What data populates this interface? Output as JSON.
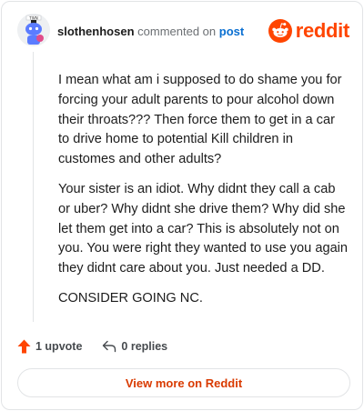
{
  "comment": {
    "username": "slothenhosen",
    "action_text": "commented on",
    "post_link_text": "post",
    "avatar_icon": "snoo-avatar-icon",
    "paragraphs": [
      "I mean what am i supposed to do shame you for forcing your adult parents to pour alcohol down their throats??? Then force them to get in a car to drive home to potential Kill children in customes and other adults?",
      "Your sister is an idiot. Why didnt they call a cab or uber? Why didnt she drive them? Why did she let them get into a car? This is absolutely not on you. You were right they wanted to use you again they didnt care about you. Just needed a DD.",
      "CONSIDER GOING NC."
    ]
  },
  "brand": {
    "wordmark": "reddit",
    "logo_icon": "reddit-snoo-logo-icon",
    "accent_color": "#ff4500"
  },
  "footer": {
    "upvote_label": "1 upvote",
    "upvote_icon": "upvote-arrow-icon",
    "upvote_color": "#ff4500",
    "reply_label": "0 replies",
    "reply_icon": "reply-arrow-icon",
    "view_more_label": "View more on Reddit",
    "view_more_color": "#d93a00"
  }
}
